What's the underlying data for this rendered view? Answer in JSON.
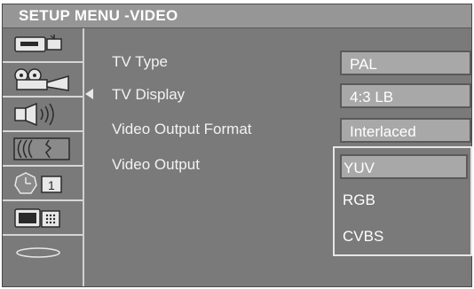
{
  "title": "SETUP MENU -VIDEO",
  "sidebar": {
    "items": [
      {
        "icon": "general-setup-icon",
        "active": false
      },
      {
        "icon": "video-camera-icon",
        "active": true
      },
      {
        "icon": "speaker-icon",
        "active": false
      },
      {
        "icon": "audio-wave-icon",
        "active": false
      },
      {
        "icon": "clock-icon",
        "active": false,
        "badge": "1"
      },
      {
        "icon": "tv-screen-icon",
        "active": false
      },
      {
        "icon": "disc-icon",
        "active": false
      }
    ]
  },
  "settings": [
    {
      "label": "TV Type",
      "value": "PAL"
    },
    {
      "label": "TV Display",
      "value": "4:3 LB"
    },
    {
      "label": "Video Output Format",
      "value": "Interlaced"
    },
    {
      "label": "Video Output",
      "value": ""
    }
  ],
  "dropdown": {
    "options": [
      "YUV",
      "RGB",
      "CVBS"
    ],
    "selected": "YUV"
  },
  "colors": {
    "background": "#7a7a7a",
    "titlebar": "#969696",
    "value_box": "#a8a8a8",
    "text": "#ffffff"
  }
}
